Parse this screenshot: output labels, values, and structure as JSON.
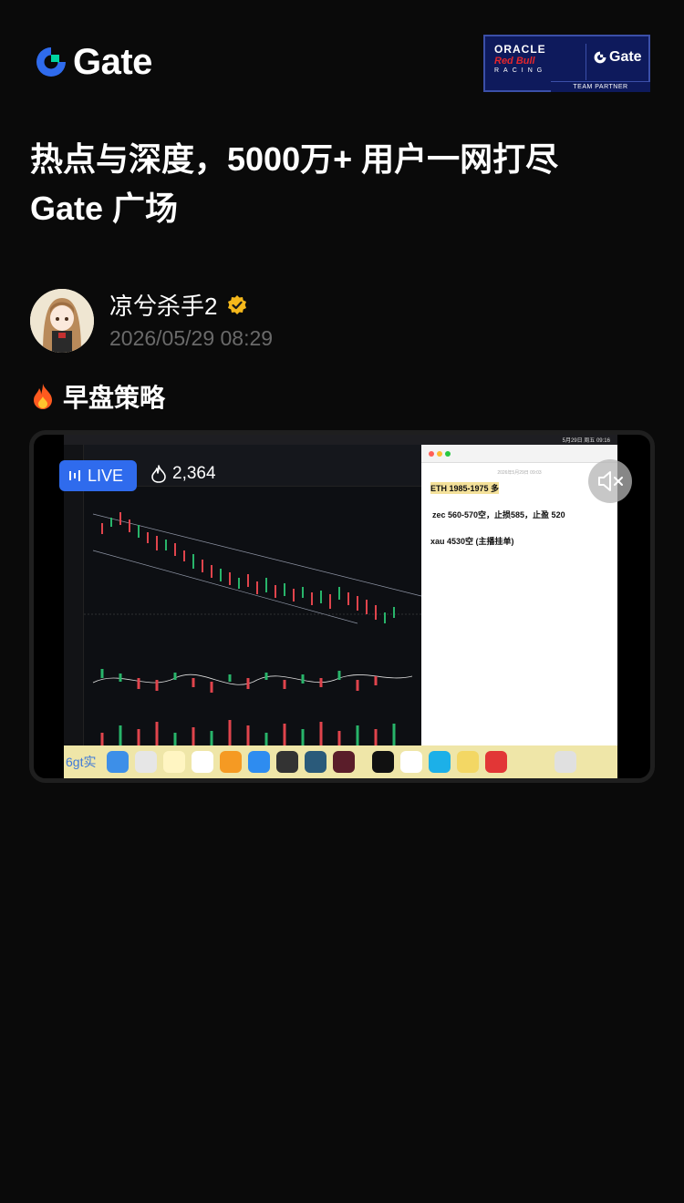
{
  "header": {
    "logo_text": "Gate",
    "partner": {
      "oracle": "ORACLE",
      "redbull": "Red Bull",
      "racing": "RACING",
      "gate": "Gate",
      "team_partner": "TEAM PARTNER"
    }
  },
  "headline": {
    "line1": "热点与深度，5000万+ 用户一网打尽",
    "line2": "Gate 广场"
  },
  "author": {
    "name": "凉兮杀手2",
    "time": "2026/05/29 08:29"
  },
  "post": {
    "title": "早盘策略"
  },
  "video": {
    "live_label": "LIVE",
    "viewers": "2,364",
    "screen": {
      "clock": "5月29日 周五 09:16",
      "notes": {
        "date": "2026年5月29日 09:03",
        "line1": "ETH 1985-1975 多",
        "line2": "zec 560-570空，止损585，止盈 520",
        "line3": "xau 4530空 (主播挂单)"
      },
      "dock_label": "6gt实"
    }
  },
  "colors": {
    "background": "#0a0a0a",
    "gate_blue": "#2f6bed",
    "gate_green": "#00d4a1",
    "live_blue": "#2f6bed",
    "muted_text": "#6a6a6a",
    "verified_gold": "#f5b81b"
  },
  "icons": [
    "gate-logo-icon",
    "verified-icon",
    "fire-icon",
    "live-bars-icon",
    "viewers-flame-icon",
    "mute-icon"
  ]
}
